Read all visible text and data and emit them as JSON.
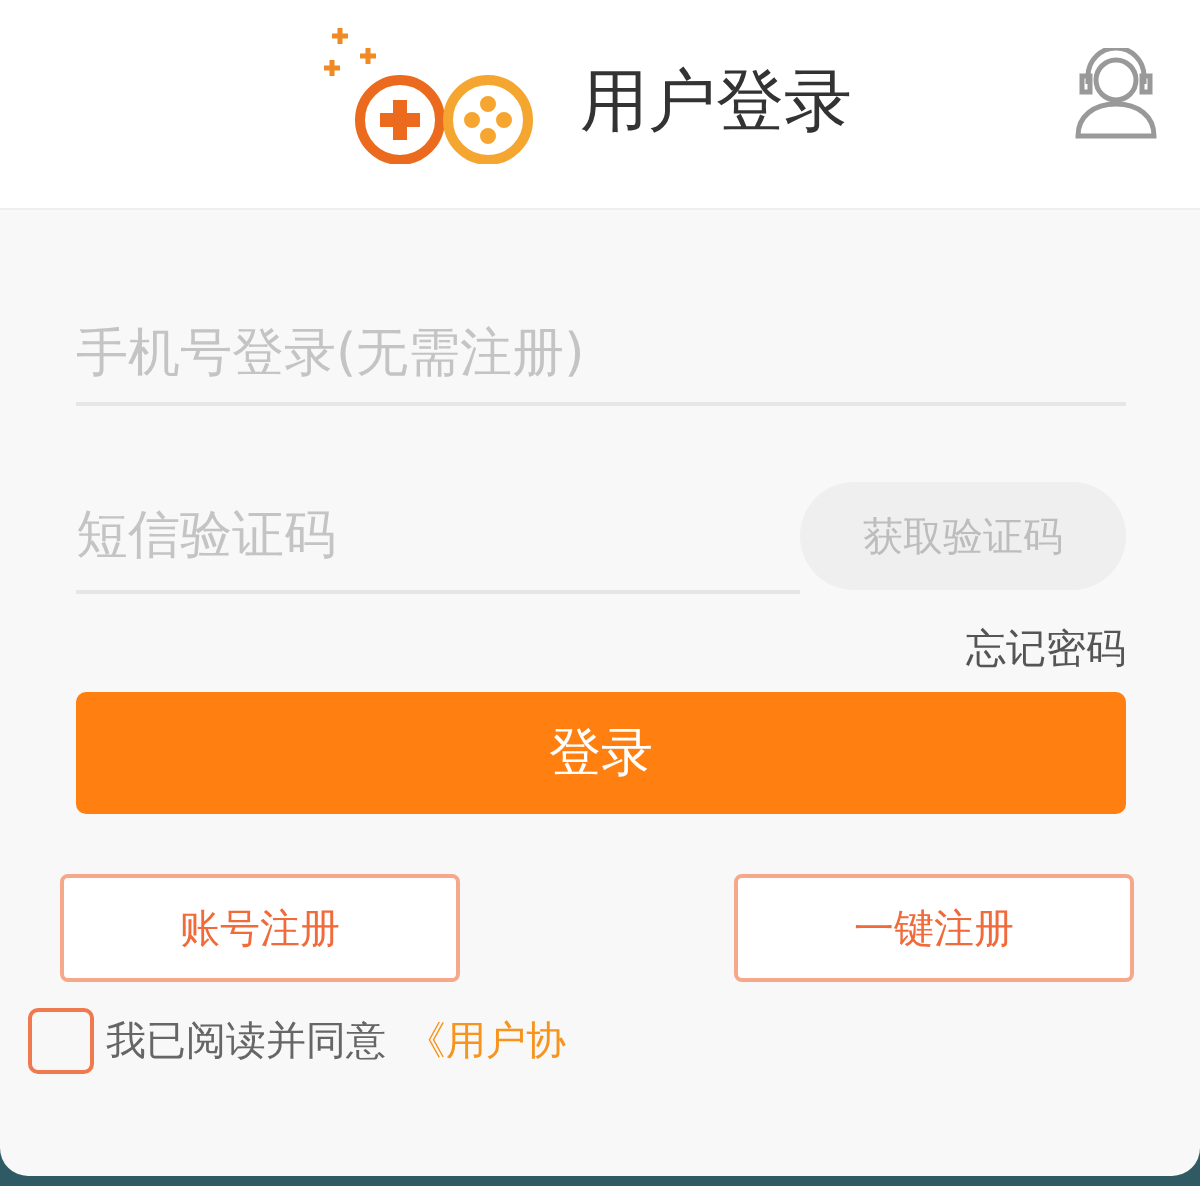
{
  "header": {
    "title": "用户登录"
  },
  "phone_field": {
    "placeholder": "手机号登录(无需注册)"
  },
  "code_field": {
    "placeholder": "短信验证码"
  },
  "get_code_button": {
    "label": "获取验证码",
    "disabled": true
  },
  "forgot_link": "忘记密码",
  "login_button": "登录",
  "register_buttons": [
    "账号注册",
    "一键注册"
  ],
  "agreement": {
    "checked": false,
    "text": "我已阅读并同意",
    "link": "《用户协"
  }
}
